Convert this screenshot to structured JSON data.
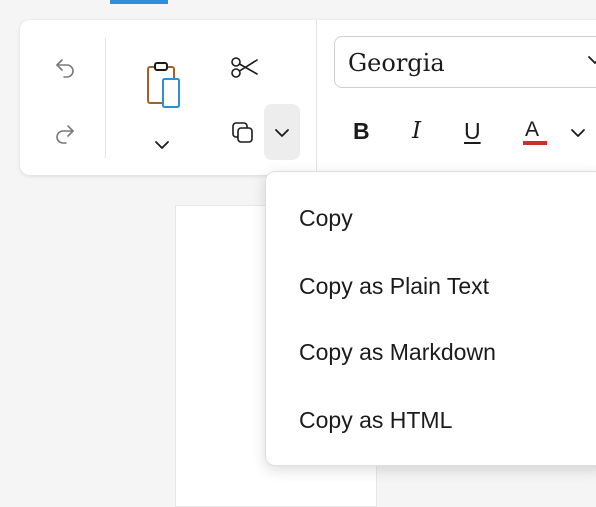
{
  "toolbar": {
    "undo_icon": "undo-icon",
    "redo_icon": "redo-icon",
    "paste_icon": "clipboard-icon",
    "cut_icon": "scissors-icon",
    "copy_icon": "copy-icon",
    "font_family": "Georgia",
    "bold_label": "B",
    "italic_label": "I",
    "underline_label": "U",
    "font_color_label": "A",
    "font_color": "#c8322b"
  },
  "copy_menu": {
    "items": [
      {
        "label": "Copy"
      },
      {
        "label": "Copy as Plain Text"
      },
      {
        "label": "Copy as Markdown"
      },
      {
        "label": "Copy as HTML"
      }
    ]
  },
  "colors": {
    "accent": "#2f8fd6",
    "clipboard_brown": "#a0622a",
    "clipboard_blue": "#2d8fd5"
  }
}
